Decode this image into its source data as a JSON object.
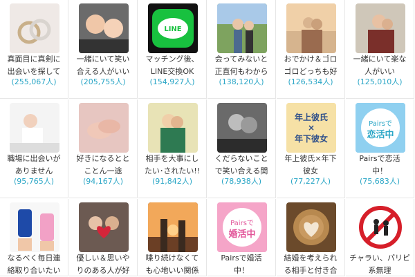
{
  "communities": [
    {
      "title": "真面目に真剣に\n出会いを探して",
      "count": "(255,067人)",
      "icon": "rings-photo"
    },
    {
      "title": "一緒にいて笑い\n合える人がいい",
      "count": "(205,755人)",
      "icon": "couple-selfie-photo"
    },
    {
      "title": "マッチング後、\nLINE交換OK",
      "count": "(154,927人)",
      "icon": "line-app-icon",
      "badge": "LINE"
    },
    {
      "title": "会ってみないと\n正直何もわから",
      "count": "(138,120人)",
      "icon": "couple-outdoor-photo"
    },
    {
      "title": "おでかけ＆ゴロ\nゴロどっちも好",
      "count": "(126,534人)",
      "icon": "couple-sunset-photo"
    },
    {
      "title": "一緒にいて楽な\n人がいい",
      "count": "(125,010人)",
      "icon": "couple-hug-photo"
    },
    {
      "title": "職場に出会いが\nありません",
      "count": "(95,765人)",
      "icon": "woman-desk-photo"
    },
    {
      "title": "好きになるとと\nことん一途",
      "count": "(94,167人)",
      "icon": "hands-photo"
    },
    {
      "title": "相手を大事にし\nたい･されたい!!",
      "count": "(91,842人)",
      "icon": "couple-embrace-photo"
    },
    {
      "title": "くだらないこと\nで笑い合える関",
      "count": "(78,938人)",
      "icon": "couple-bw-photo"
    },
    {
      "title": "年上彼氏×年下\n彼女",
      "count": "(77,227人)",
      "icon": "age-gap-badge",
      "badge": "年上彼氏\n×\n年下彼女"
    },
    {
      "title": "Pairsで恋活\n中！",
      "count": "(75,683人)",
      "icon": "pairs-koikatsu-badge",
      "badge": "Pairsで\n恋活中"
    },
    {
      "title": "なるべく毎日連\n絡取り合いたい",
      "count": "",
      "icon": "phone-photo"
    },
    {
      "title": "優しい＆思いや\nりのある人が好",
      "count": "",
      "icon": "heart-balloon-photo"
    },
    {
      "title": "喋り続けなくて\nも心地いい関係",
      "count": "",
      "icon": "silhouette-sunset-photo"
    },
    {
      "title": "Pairsで婚活\n中！",
      "count": "",
      "icon": "pairs-konkatsu-badge",
      "badge": "Pairsで\n婚活中"
    },
    {
      "title": "結婚を考えられ\nる相手と付き合",
      "count": "",
      "icon": "latte-heart-photo"
    },
    {
      "title": "チャラい、パリピ\n系無理",
      "count": "",
      "icon": "no-party-sign"
    }
  ]
}
